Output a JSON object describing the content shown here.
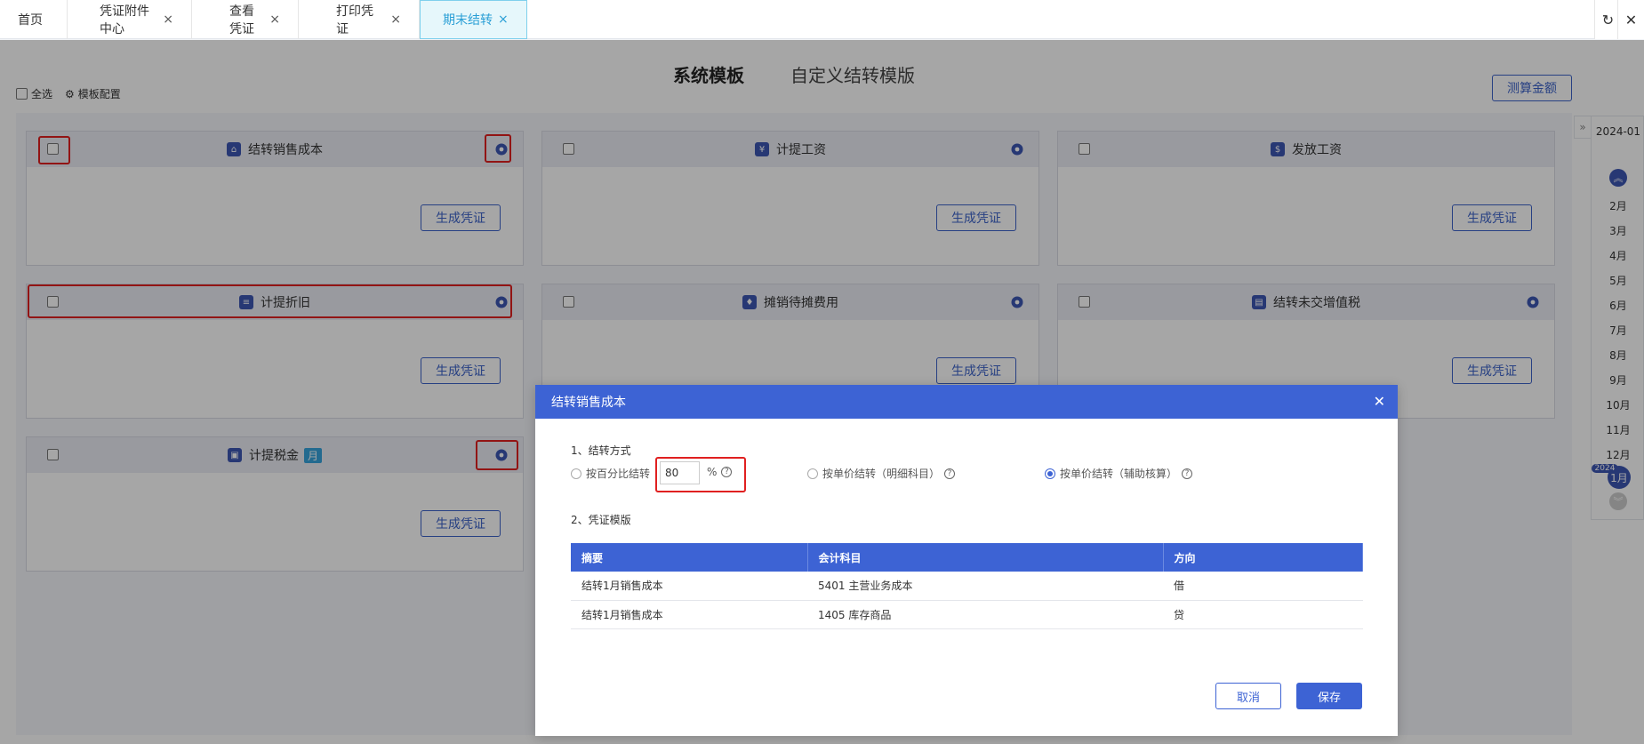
{
  "tabs": [
    {
      "label": "首页",
      "closable": false
    },
    {
      "label": "凭证附件中心",
      "closable": true
    },
    {
      "label": "查看凭证",
      "closable": true
    },
    {
      "label": "打印凭证",
      "closable": true
    },
    {
      "label": "期末结转",
      "closable": true,
      "active": true
    }
  ],
  "tab_close_glyph": "×",
  "window_icons": {
    "refresh": "↻",
    "close": "✕"
  },
  "mode_tabs": {
    "system": "系统模板",
    "custom": "自定义结转模版"
  },
  "toolbar": {
    "select_all": "全选",
    "template_config": "模板配置",
    "measure": "测算金额"
  },
  "cards": [
    {
      "title": "结转销售成本",
      "button": "生成凭证"
    },
    {
      "title": "计提工资",
      "button": "生成凭证"
    },
    {
      "title": "发放工资",
      "button": "生成凭证"
    },
    {
      "title": "计提折旧",
      "button": "生成凭证"
    },
    {
      "title": "摊销待摊费用",
      "button": "生成凭证"
    },
    {
      "title": "结转未交增值税",
      "button": "生成凭证"
    },
    {
      "title": "计提税金",
      "badge": "月",
      "button": "生成凭证"
    }
  ],
  "monthbar": {
    "period": "2024-01",
    "months": [
      "2月",
      "3月",
      "4月",
      "5月",
      "6月",
      "7月",
      "8月",
      "9月",
      "10月",
      "11月",
      "12月"
    ],
    "current_year": "2024",
    "current_month": "1月"
  },
  "modal": {
    "title": "结转销售成本",
    "section1": "1、结转方式",
    "options": [
      {
        "label": "按百分比结转",
        "selected": false
      },
      {
        "label": "按单价结转（明细科目）",
        "selected": false
      },
      {
        "label": "按单价结转（辅助核算）",
        "selected": true
      }
    ],
    "percent_value": "80",
    "percent_sign": "%",
    "section2": "2、凭证模版",
    "table": {
      "headers": [
        "摘要",
        "会计科目",
        "方向"
      ],
      "rows": [
        [
          "结转1月销售成本",
          "5401 主营业务成本",
          "借"
        ],
        [
          "结转1月销售成本",
          "1405 库存商品",
          "贷"
        ]
      ]
    },
    "cancel": "取消",
    "save": "保存"
  },
  "colors": {
    "primary": "#3d63d4",
    "highlight": "#e02020",
    "active_tab": "#2a9fd6"
  }
}
